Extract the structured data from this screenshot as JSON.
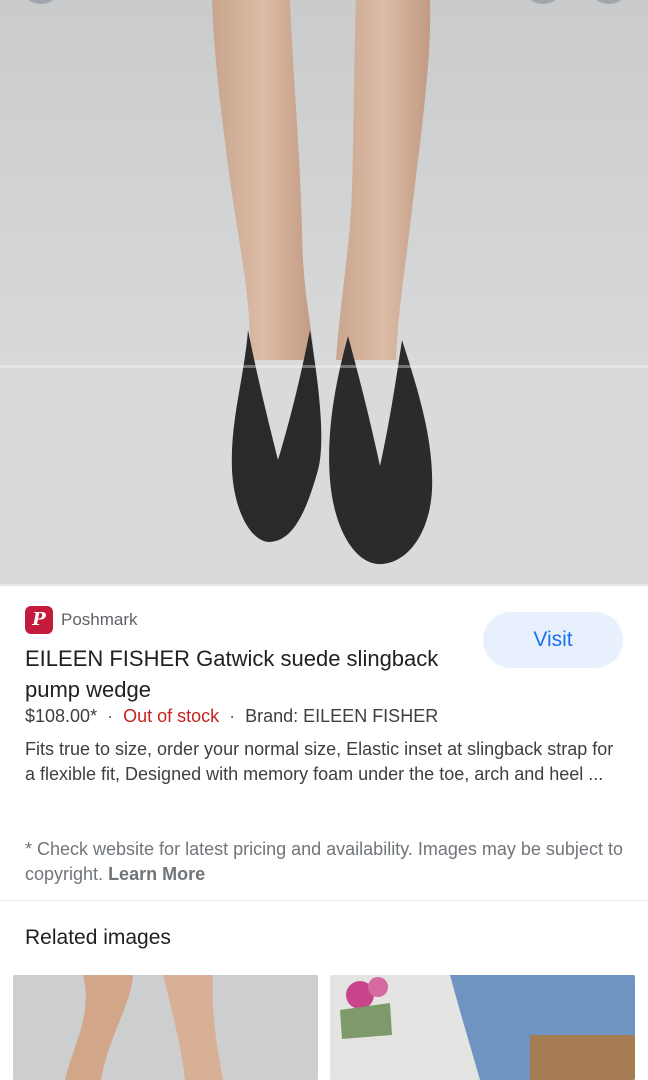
{
  "source": {
    "name": "Poshmark",
    "favicon_letter": "P",
    "brand_color": "#c41b3d"
  },
  "visit_label": "Visit",
  "product": {
    "title": "EILEEN FISHER Gatwick suede slingback pump wedge",
    "price": "$108.00*",
    "separator": "·",
    "stock": "Out of stock",
    "brand": "Brand: EILEEN FISHER",
    "description": "Fits true to size, order your normal size, Elastic inset at slingback strap for a flexible fit, Designed with memory foam under the toe, arch and heel ..."
  },
  "disclaimer": {
    "text": "* Check website for latest pricing and availability. Images may be subject to copyright.",
    "learn_more": "Learn More"
  },
  "related": {
    "title": "Related images"
  },
  "colors": {
    "accent": "#1a73e8",
    "visit_bg": "#e8f0fe",
    "out_of_stock": "#c5221f"
  },
  "icons": [
    "poshmark-favicon"
  ]
}
